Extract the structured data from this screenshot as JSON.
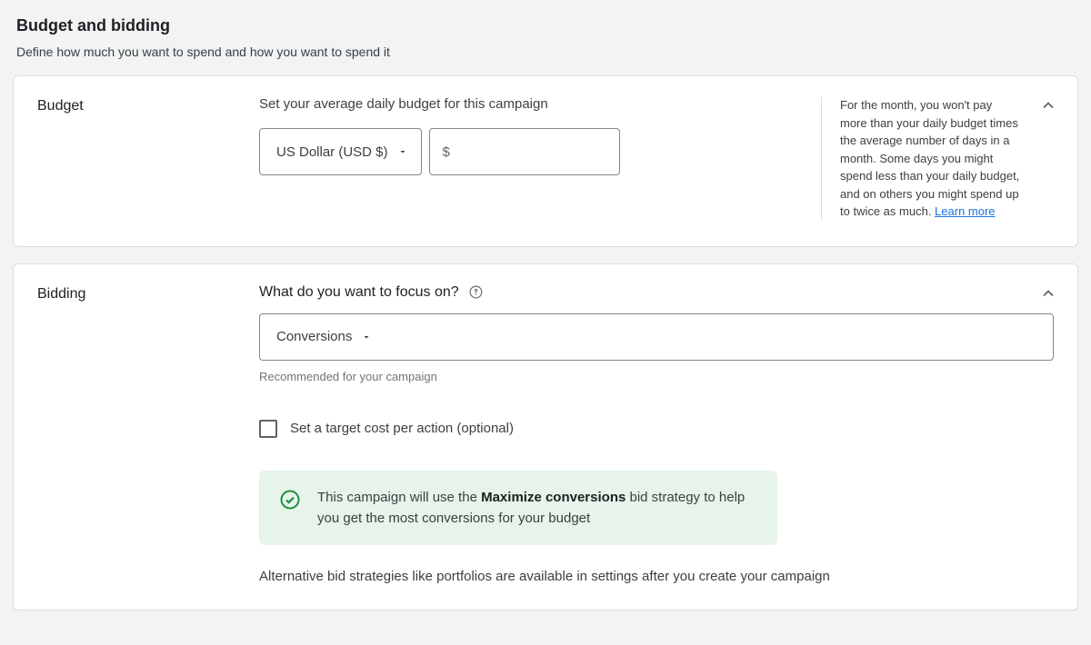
{
  "page": {
    "title": "Budget and bidding",
    "subtitle": "Define how much you want to spend and how you want to spend it"
  },
  "budget": {
    "section_label": "Budget",
    "prompt": "Set your average daily budget for this campaign",
    "currency_select": "US Dollar (USD $)",
    "currency_symbol": "$",
    "amount_value": "",
    "help_text": "For the month, you won't pay more than your daily budget times the average number of days in a month. Some days you might spend less than your daily budget, and on others you might spend up to twice as much. ",
    "learn_more": "Learn more"
  },
  "bidding": {
    "section_label": "Bidding",
    "focus_question": "What do you want to focus on?",
    "focus_value": "Conversions",
    "recommended_note": "Recommended for your campaign",
    "target_cpa_label": "Set a target cost per action (optional)",
    "banner_pre": "This campaign will use the ",
    "banner_bold": "Maximize conversions",
    "banner_post": " bid strategy to help you get the most conversions for your budget",
    "alt_note": "Alternative bid strategies like portfolios are available in settings after you create your campaign"
  }
}
